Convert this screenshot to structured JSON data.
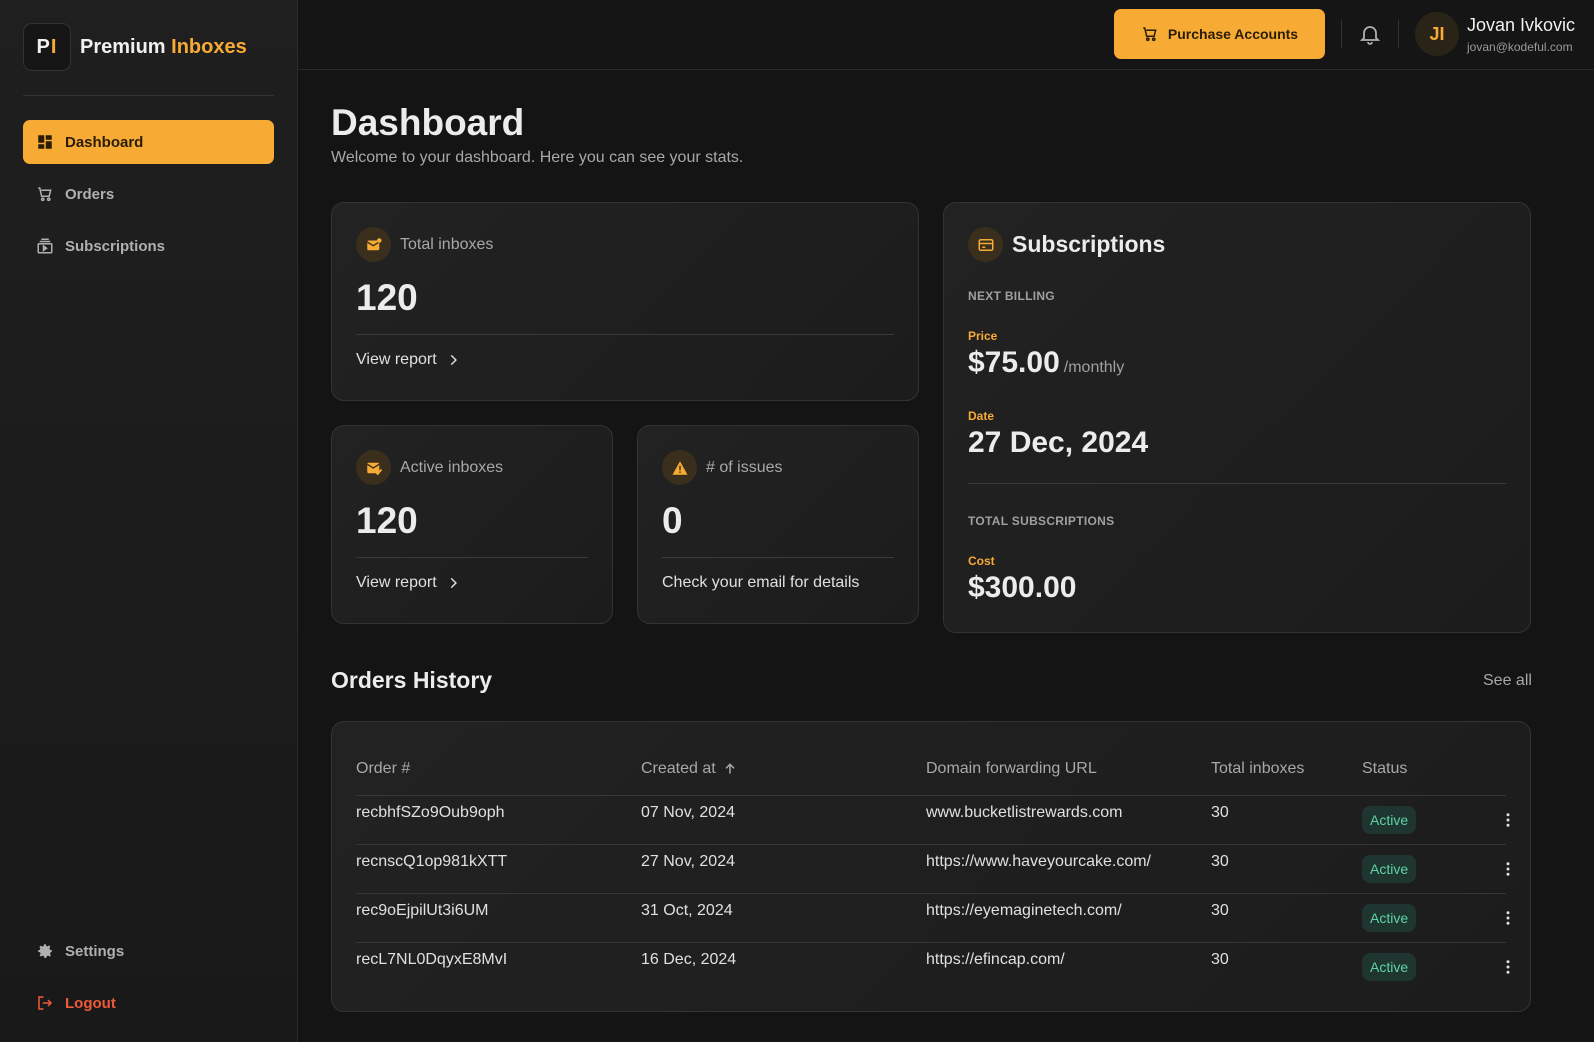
{
  "brand": {
    "logo_left": "P",
    "logo_right": "I",
    "name_first": "Premium",
    "name_second": "Inboxes"
  },
  "sidebar": {
    "items": [
      {
        "label": "Dashboard",
        "icon": "dashboard-icon",
        "active": true
      },
      {
        "label": "Orders",
        "icon": "cart-icon",
        "active": false
      },
      {
        "label": "Subscriptions",
        "icon": "subscriptions-icon",
        "active": false
      }
    ],
    "bottom": [
      {
        "label": "Settings",
        "icon": "gear-icon"
      },
      {
        "label": "Logout",
        "icon": "logout-icon"
      }
    ]
  },
  "topbar": {
    "purchase_label": "Purchase Accounts",
    "user_initials": "JI",
    "user_name": "Jovan Ivkovic",
    "user_email": "jovan@kodeful.com"
  },
  "page": {
    "title": "Dashboard",
    "subtitle": "Welcome to your dashboard. Here you can see your stats."
  },
  "stats": {
    "total": {
      "label": "Total inboxes",
      "value": "120",
      "foot": "View report"
    },
    "active": {
      "label": "Active inboxes",
      "value": "120",
      "foot": "View report"
    },
    "issues": {
      "label": "# of issues",
      "value": "0",
      "foot": "Check your email for details"
    }
  },
  "subscriptions": {
    "title": "Subscriptions",
    "next_billing_label": "NEXT BILLING",
    "price_label": "Price",
    "price_value": "$75.00",
    "price_unit": "/monthly",
    "date_label": "Date",
    "date_value": "27 Dec, 2024",
    "total_label": "TOTAL SUBSCRIPTIONS",
    "cost_label": "Cost",
    "cost_value": "$300.00"
  },
  "orders": {
    "title": "Orders History",
    "see_all": "See all",
    "headers": [
      "Order #",
      "Created at",
      "Domain forwarding URL",
      "Total inboxes",
      "Status"
    ],
    "rows": [
      {
        "id": "recbhfSZo9Oub9oph",
        "created": "07 Nov, 2024",
        "url": "www.bucketlistrewards.com",
        "inboxes": "30",
        "status": "Active"
      },
      {
        "id": "recnscQ1op981kXTT",
        "created": "27 Nov, 2024",
        "url": "https://www.haveyourcake.com/",
        "inboxes": "30",
        "status": "Active"
      },
      {
        "id": "rec9oEjpilUt3i6UM",
        "created": "31 Oct, 2024",
        "url": "https://eyemaginetech.com/",
        "inboxes": "30",
        "status": "Active"
      },
      {
        "id": "recL7NL0DqyxE8MvI",
        "created": "16 Dec, 2024",
        "url": "https://efincap.com/",
        "inboxes": "30",
        "status": "Active"
      }
    ]
  },
  "colors": {
    "accent": "#f7ab35",
    "status_active": "#5fd3a5",
    "logout": "#f05a3a"
  }
}
